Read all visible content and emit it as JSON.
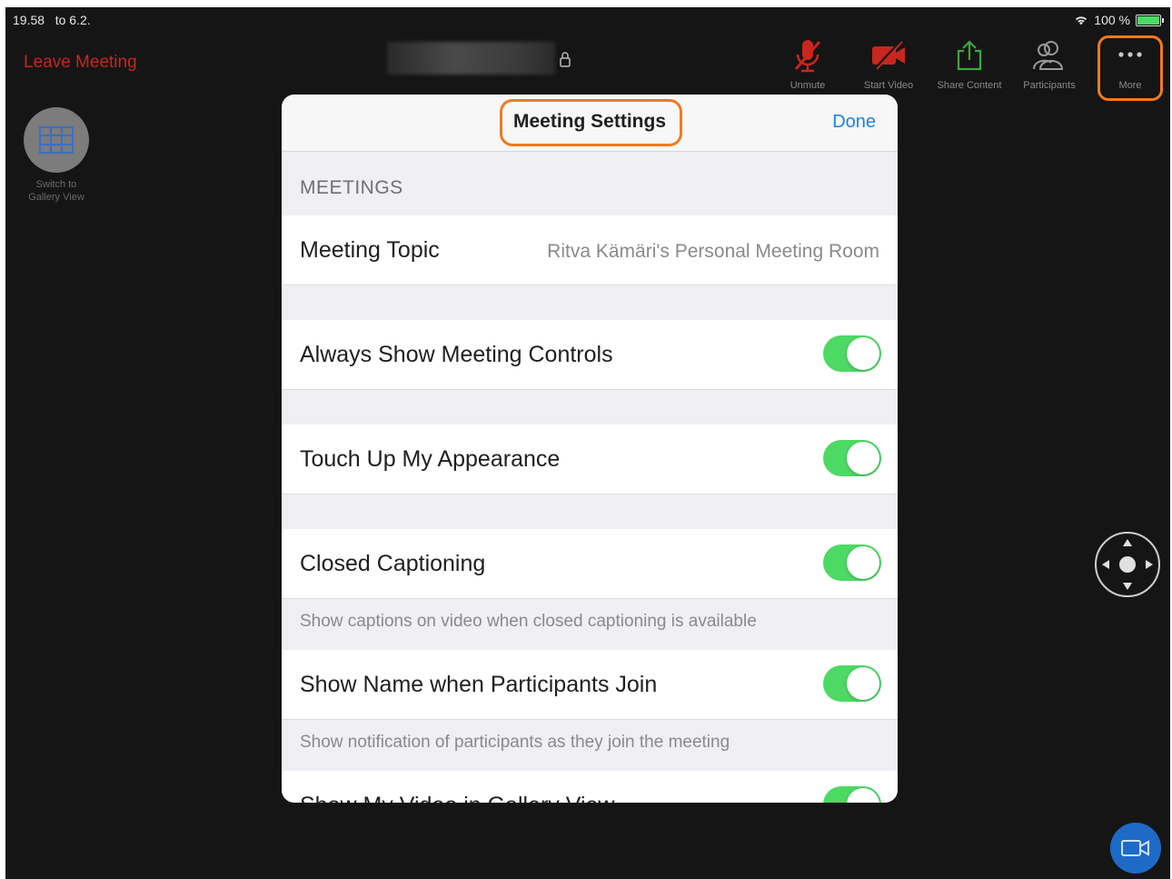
{
  "status_bar": {
    "time": "19.58",
    "date": "to 6.2.",
    "battery": "100 %",
    "battery_level": 1.0
  },
  "toolbar": {
    "leave_label": "Leave Meeting",
    "tools": [
      {
        "label": "Unmute",
        "icon": "muted-mic-icon",
        "color": "#c8261e"
      },
      {
        "label": "Start Video",
        "icon": "video-off-icon",
        "color": "#c8261e"
      },
      {
        "label": "Share Content",
        "icon": "share-icon",
        "color": "#3aa83a"
      },
      {
        "label": "Participants",
        "icon": "participants-icon",
        "color": "#9a9a9a"
      },
      {
        "label": "More",
        "icon": "more-dots-icon",
        "color": "#9a9a9a"
      }
    ]
  },
  "gallery": {
    "label_line1": "Switch to",
    "label_line2": "Gallery View"
  },
  "modal": {
    "title": "Meeting Settings",
    "done_label": "Done",
    "section_title": "MEETINGS",
    "topic_label": "Meeting Topic",
    "topic_value": "Ritva Kämäri's Personal Meeting Room",
    "settings": [
      {
        "label": "Always Show Meeting Controls",
        "enabled": true,
        "description": ""
      },
      {
        "label": "Touch Up My Appearance",
        "enabled": true,
        "description": ""
      },
      {
        "label": "Closed Captioning",
        "enabled": true,
        "description": "Show captions on video when closed captioning is available"
      },
      {
        "label": "Show Name when Participants Join",
        "enabled": true,
        "description": "Show notification of participants as they join the meeting"
      },
      {
        "label": "Show My Video in Gallery View",
        "enabled": true,
        "description": ""
      }
    ]
  },
  "colors": {
    "accent": "#1e82e6",
    "highlight": "#f07a1e",
    "toggle_on": "#4cd964",
    "danger": "#c8261e"
  }
}
